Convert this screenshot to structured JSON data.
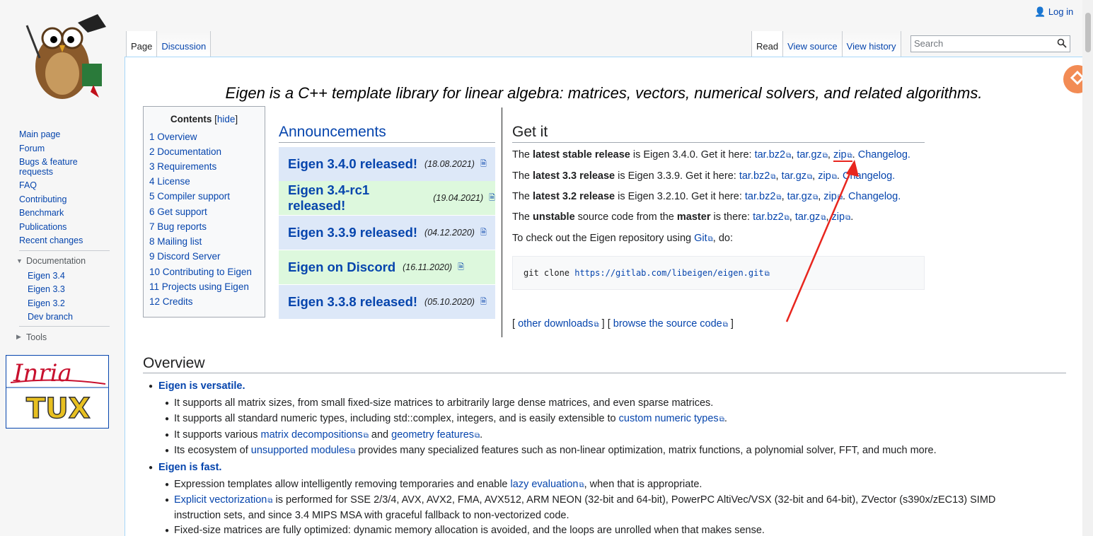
{
  "header": {
    "login": "Log in",
    "tabs_left": [
      "Page",
      "Discussion"
    ],
    "tabs_right": [
      "Read",
      "View source",
      "View history"
    ],
    "search_placeholder": "Search"
  },
  "sidebar": {
    "nav": [
      "Main page",
      "Forum",
      "Bugs & feature",
      "requests",
      "FAQ",
      "Contributing",
      "Benchmark",
      "Publications",
      "Recent changes"
    ],
    "doc_heading": "Documentation",
    "doc_items": [
      "Eigen 3.4",
      "Eigen 3.3",
      "Eigen 3.2",
      "Dev branch"
    ],
    "tools": "Tools"
  },
  "content": {
    "tagline": "Eigen is a C++ template library for linear algebra: matrices, vectors, numerical solvers, and related algorithms.",
    "toc": {
      "title": "Contents",
      "hide": "hide",
      "items": [
        "1 Overview",
        "2 Documentation",
        "3 Requirements",
        "4 License",
        "5 Compiler support",
        "6 Get support",
        "7 Bug reports",
        "8 Mailing list",
        "9 Discord Server",
        "10 Contributing to Eigen",
        "11 Projects using Eigen",
        "12 Credits"
      ]
    },
    "announcements": {
      "title": "Announcements",
      "items": [
        {
          "title": "Eigen 3.4.0 released!",
          "date": "(18.08.2021)"
        },
        {
          "title": "Eigen 3.4-rc1 released!",
          "date": "(19.04.2021)"
        },
        {
          "title": "Eigen 3.3.9 released!",
          "date": "(04.12.2020)"
        },
        {
          "title": "Eigen on Discord",
          "date": "(16.11.2020)"
        },
        {
          "title": "Eigen 3.3.8 released!",
          "date": "(05.10.2020)"
        }
      ]
    },
    "getit": {
      "title": "Get it",
      "l1": {
        "a": "The ",
        "b": "latest stable release",
        "c": " is Eigen 3.4.0. Get it here: "
      },
      "l2": {
        "a": "The ",
        "b": "latest 3.3 release",
        "c": " is Eigen 3.3.9. Get it here: "
      },
      "l3": {
        "a": "The ",
        "b": "latest 3.2 release",
        "c": " is Eigen 3.2.10. Get it here: "
      },
      "l4": {
        "a": "The ",
        "b": "unstable",
        "c": " source code from the ",
        "d": "master",
        "e": " is there: "
      },
      "l5": {
        "a": "To check out the Eigen repository using ",
        "git": "Git",
        ",do": ", do:"
      },
      "tarbz2": "tar.bz2",
      "targz": "tar.gz",
      "zip": "zip",
      "changelog": "Changelog.",
      "code_cmd": "git clone ",
      "code_url": "https://gitlab.com/libeigen/eigen.git",
      "other": "other downloads",
      "browse": "browse the source code"
    },
    "overview": {
      "title": "Overview",
      "versatile": "Eigen is versatile.",
      "v1": "It supports all matrix sizes, from small fixed-size matrices to arbitrarily large dense matrices, and even sparse matrices.",
      "v2a": "It supports all standard numeric types, including std::complex, integers, and is easily extensible to ",
      "v2link": "custom numeric types",
      "v3a": "It supports various ",
      "v3link1": "matrix decompositions",
      "v3b": " and ",
      "v3link2": "geometry features",
      "v4a": "Its ecosystem of ",
      "v4link": "unsupported modules",
      "v4b": " provides many specialized features such as non-linear optimization, matrix functions, a polynomial solver, FFT, and much more.",
      "fast": "Eigen is fast.",
      "f1a": "Expression templates allow intelligently removing temporaries and enable ",
      "f1link": "lazy evaluation",
      "f1b": ", when that is appropriate.",
      "f2link": "Explicit vectorization",
      "f2a": " is performed for SSE 2/3/4, AVX, AVX2, FMA, AVX512, ARM NEON (32-bit and 64-bit), PowerPC AltiVec/VSX (32-bit and 64-bit), ZVector (s390x/zEC13) SIMD",
      "f2b": "instruction sets, and since 3.4 MIPS MSA with graceful fallback to non-vectorized code.",
      "f3": "Fixed-size matrices are fully optimized: dynamic memory allocation is avoided, and the loops are unrolled when that makes sense."
    }
  },
  "colors": {
    "link": "#0645ad",
    "annotation_arrow": "#e8261e"
  }
}
